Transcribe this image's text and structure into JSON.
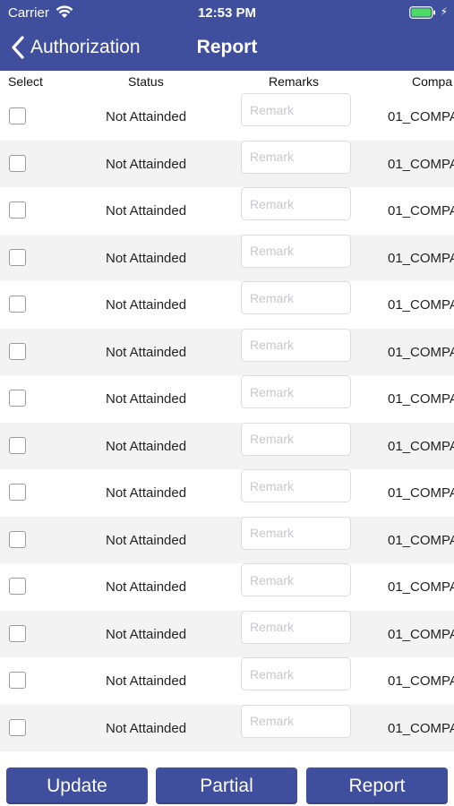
{
  "status_bar": {
    "carrier": "Carrier",
    "time": "12:53 PM"
  },
  "nav": {
    "back_label": "Authorization",
    "title": "Report"
  },
  "table": {
    "headers": {
      "select": "Select",
      "status": "Status",
      "remarks": "Remarks",
      "company": "Compa"
    },
    "remark_placeholder": "Remark",
    "rows": [
      {
        "status": "Not Attainded",
        "company": "01_COMPA"
      },
      {
        "status": "Not Attainded",
        "company": "01_COMPA"
      },
      {
        "status": "Not Attainded",
        "company": "01_COMPA"
      },
      {
        "status": "Not Attainded",
        "company": "01_COMPA"
      },
      {
        "status": "Not Attainded",
        "company": "01_COMPA"
      },
      {
        "status": "Not Attainded",
        "company": "01_COMPA"
      },
      {
        "status": "Not Attainded",
        "company": "01_COMPA"
      },
      {
        "status": "Not Attainded",
        "company": "01_COMPA"
      },
      {
        "status": "Not Attainded",
        "company": "01_COMPA"
      },
      {
        "status": "Not Attainded",
        "company": "01_COMPA"
      },
      {
        "status": "Not Attainded",
        "company": "01_COMPA"
      },
      {
        "status": "Not Attainded",
        "company": "01_COMPA"
      },
      {
        "status": "Not Attainded",
        "company": "01_COMPA"
      },
      {
        "status": "Not Attainded",
        "company": "01_COMPA"
      }
    ]
  },
  "buttons": {
    "update": "Update",
    "partial": "Partial",
    "report": "Report"
  },
  "colors": {
    "header_bg": "#3f4f9e",
    "button_bg": "#3f4f9e",
    "alt_row_bg": "#f3f3f3",
    "battery": "#4cd964"
  }
}
